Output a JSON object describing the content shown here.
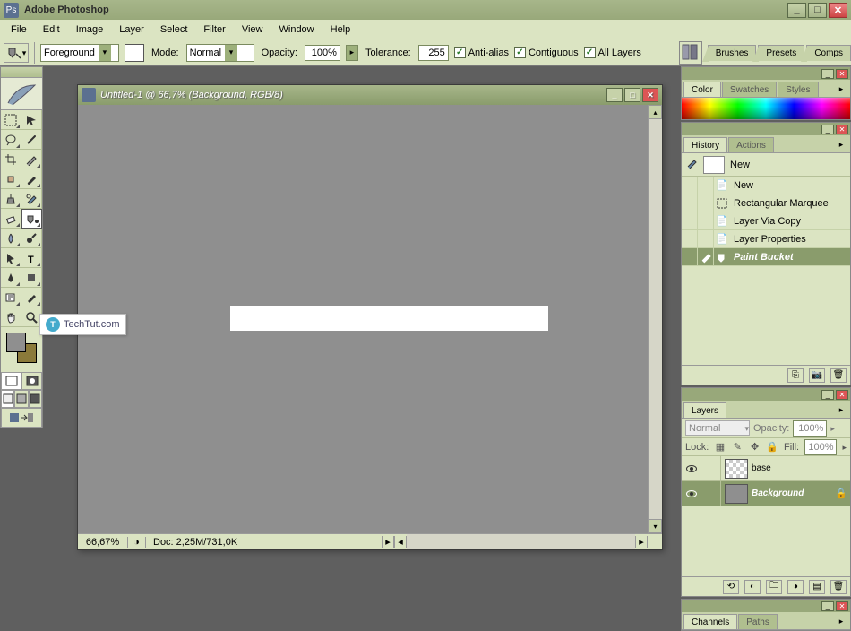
{
  "app": {
    "title": "Adobe Photoshop"
  },
  "menu": {
    "items": [
      "File",
      "Edit",
      "Image",
      "Layer",
      "Select",
      "Filter",
      "View",
      "Window",
      "Help"
    ]
  },
  "options": {
    "fill": "Foreground",
    "mode_label": "Mode:",
    "mode": "Normal",
    "opacity_label": "Opacity:",
    "opacity": "100%",
    "tolerance_label": "Tolerance:",
    "tolerance": "255",
    "antialias": "Anti-alias",
    "contiguous": "Contiguous",
    "all_layers": "All Layers",
    "tabs": [
      "Brushes",
      "Presets",
      "Comps"
    ]
  },
  "document": {
    "title": "Untitled-1 @ 66,7% (Background, RGB/8)",
    "zoom": "66,67%",
    "doc_info": "Doc: 2,25M/731,0K"
  },
  "watermark": "TechTut.com",
  "color_panel": {
    "tabs": [
      "Color",
      "Swatches",
      "Styles"
    ]
  },
  "history_panel": {
    "tabs": [
      "History",
      "Actions"
    ],
    "source": "New",
    "items": [
      {
        "label": "New",
        "icon": "file"
      },
      {
        "label": "Rectangular Marquee",
        "icon": "marquee"
      },
      {
        "label": "Layer Via Copy",
        "icon": "file"
      },
      {
        "label": "Layer Properties",
        "icon": "file"
      },
      {
        "label": "Paint Bucket",
        "icon": "bucket",
        "active": true
      }
    ]
  },
  "layers_panel": {
    "tabs": [
      "Layers"
    ],
    "blend": "Normal",
    "opacity_label": "Opacity:",
    "opacity": "100%",
    "lock_label": "Lock:",
    "fill_label": "Fill:",
    "fill": "100%",
    "layers": [
      {
        "name": "base",
        "thumb": "trans",
        "active": false,
        "locked": false
      },
      {
        "name": "Background",
        "thumb": "grey",
        "active": true,
        "locked": true
      }
    ]
  },
  "channels_panel": {
    "tabs": [
      "Channels",
      "Paths"
    ]
  }
}
